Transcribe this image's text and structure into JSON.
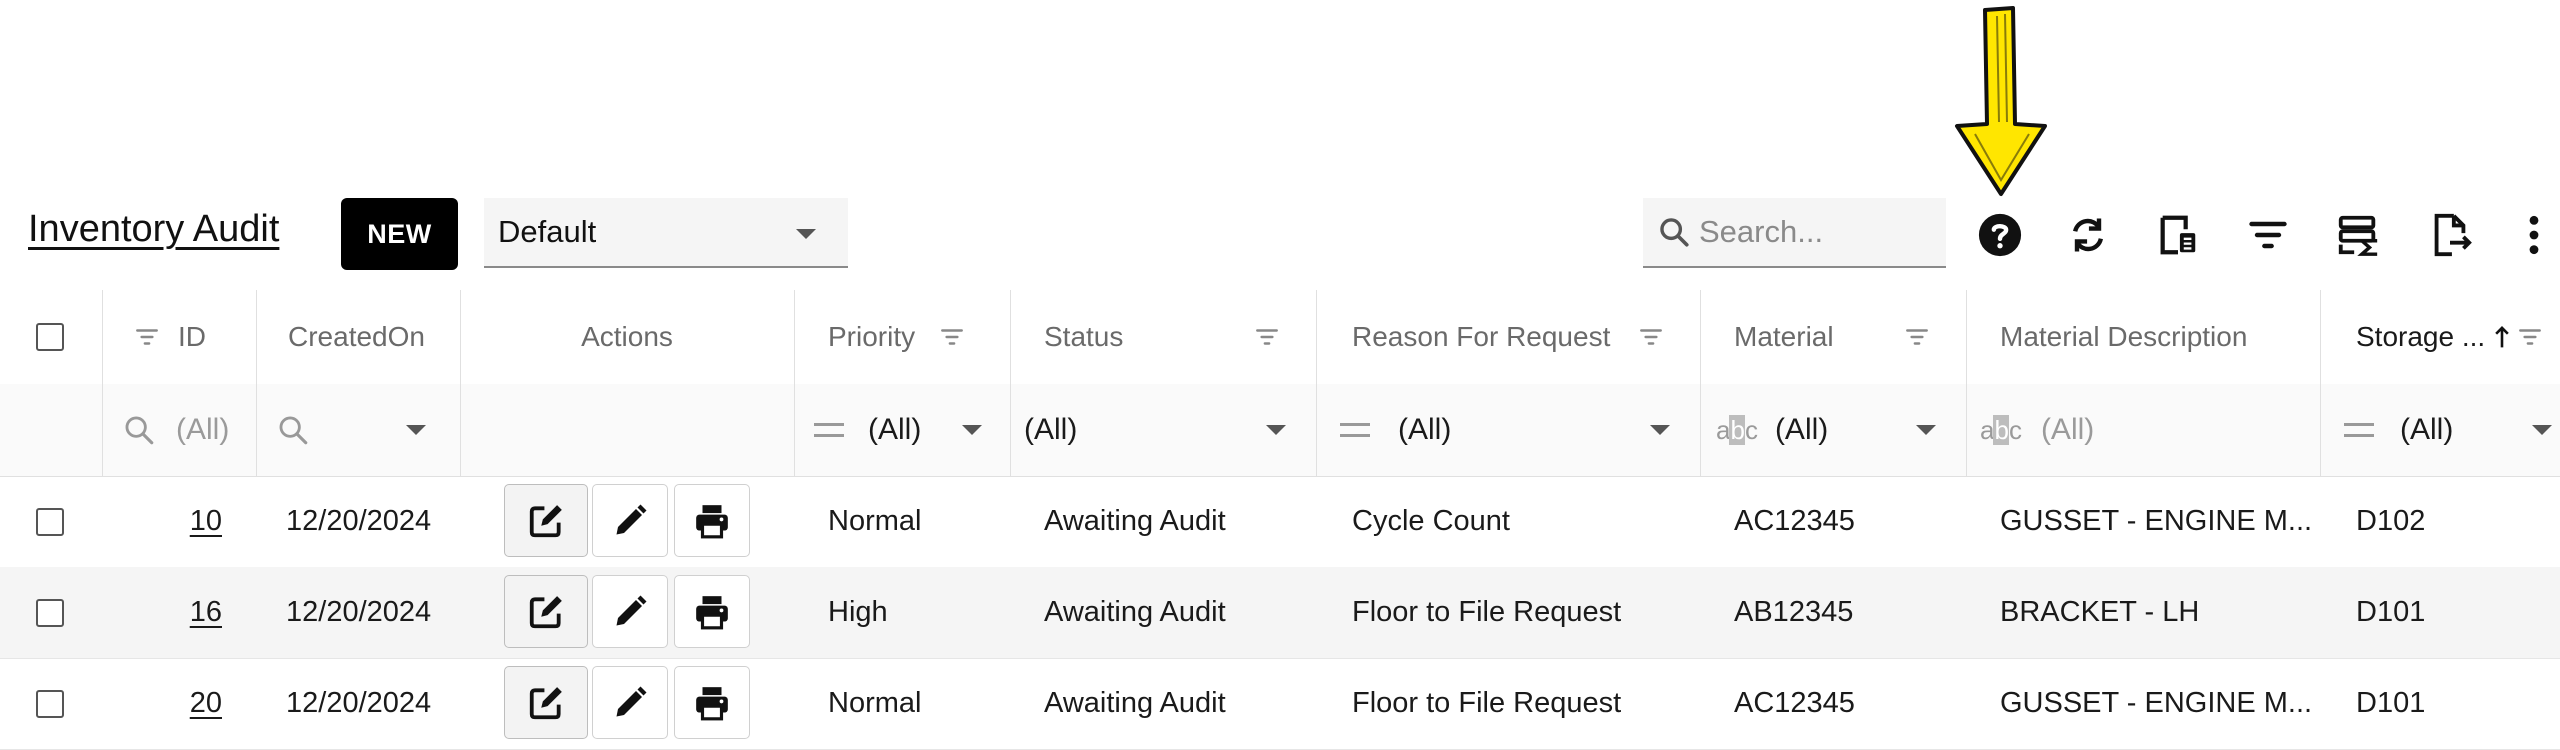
{
  "toolbar": {
    "title": "Inventory Audit",
    "new_label": "NEW",
    "view_value": "Default",
    "search_placeholder": "Search...",
    "icons": [
      "help-icon",
      "refresh-icon",
      "column-chooser-icon",
      "filter-icon",
      "summary-icon",
      "export-icon",
      "more-vert-icon"
    ]
  },
  "colors": {
    "accent_arrow": "#ffe600",
    "new_button": "#000000",
    "header_text": "#6a6a6a"
  },
  "columns": {
    "id": "ID",
    "created_on": "CreatedOn",
    "actions": "Actions",
    "priority": "Priority",
    "status": "Status",
    "reason": "Reason For Request",
    "material": "Material",
    "material_description": "Material Description",
    "storage": "Storage ..."
  },
  "filters": {
    "id": "(All)",
    "priority": "(All)",
    "status": "(All)",
    "reason": "(All)",
    "material": "(All)",
    "material_description": "(All)",
    "storage": "(All)"
  },
  "rows": [
    {
      "id": "10",
      "created_on": "12/20/2024",
      "priority": "Normal",
      "status": "Awaiting Audit",
      "reason": "Cycle Count",
      "material": "AC12345",
      "material_description": "GUSSET - ENGINE M...",
      "storage": "D102"
    },
    {
      "id": "16",
      "created_on": "12/20/2024",
      "priority": "High",
      "status": "Awaiting Audit",
      "reason": "Floor to File Request",
      "material": "AB12345",
      "material_description": "BRACKET - LH",
      "storage": "D101"
    },
    {
      "id": "20",
      "created_on": "12/20/2024",
      "priority": "Normal",
      "status": "Awaiting Audit",
      "reason": "Floor to File Request",
      "material": "AC12345",
      "material_description": "GUSSET - ENGINE M...",
      "storage": "D101"
    }
  ]
}
